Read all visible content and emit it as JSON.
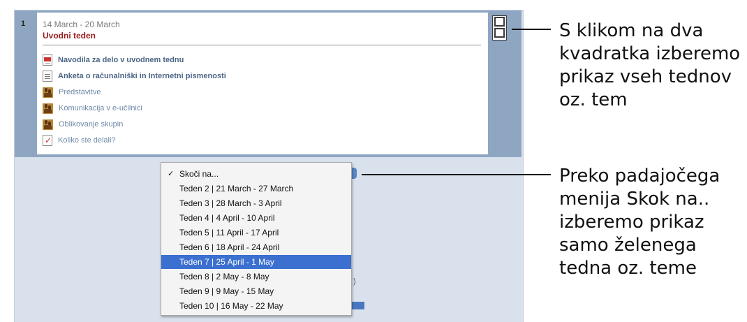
{
  "week": {
    "number": "1",
    "date_range": "14 March - 20 March",
    "title": "Uvodni teden",
    "activities": [
      {
        "icon": "pdf-icon",
        "label": "Navodila za delo v uvodnem tednu",
        "bold": true
      },
      {
        "icon": "document-icon",
        "label": "Anketa o računalniški in Internetni pismenosti",
        "bold": true
      },
      {
        "icon": "forum-icon",
        "label": "Predstavitve",
        "bold": false
      },
      {
        "icon": "forum-icon",
        "label": "Komunikacija v e-učilnici",
        "bold": false
      },
      {
        "icon": "forum-icon",
        "label": "Oblikovanje skupin",
        "bold": false
      },
      {
        "icon": "quiz-icon",
        "label": "Koliko ste delali?",
        "bold": false
      }
    ]
  },
  "jump_menu": {
    "options": [
      {
        "label": "Skoči na...",
        "checked": true,
        "selected": false
      },
      {
        "label": "Teden 2 | 21 March - 27 March",
        "checked": false,
        "selected": false
      },
      {
        "label": "Teden 3 | 28 March - 3 April",
        "checked": false,
        "selected": false
      },
      {
        "label": "Teden 4 | 4 April - 10 April",
        "checked": false,
        "selected": false
      },
      {
        "label": "Teden 5 | 11 April - 17 April",
        "checked": false,
        "selected": false
      },
      {
        "label": "Teden 6 | 18 April - 24 April",
        "checked": false,
        "selected": false
      },
      {
        "label": "Teden 7 | 25 April - 1 May",
        "checked": false,
        "selected": true
      },
      {
        "label": "Teden 8 | 2 May - 8 May",
        "checked": false,
        "selected": false
      },
      {
        "label": "Teden 9 | 9 May - 15 May",
        "checked": false,
        "selected": false
      },
      {
        "label": "Teden 10 | 16 May - 22 May",
        "checked": false,
        "selected": false
      }
    ],
    "check_mark": "✓"
  },
  "obscured": {
    "paren_text": ")"
  },
  "callouts": {
    "toggle": [
      "S klikom na dva",
      "kvadratka izberemo",
      "prikaz vseh tednov",
      "oz. tem"
    ],
    "dropdown": [
      "Preko padajočega",
      "menija Skok na..",
      "izberemo prikaz",
      "samo želenega",
      "tedna oz. teme"
    ]
  },
  "colors": {
    "panel_bg": "#d8e1ec",
    "week_side_bar": "#8ea6c2",
    "title_red": "#9b1b1b",
    "link_blue": "#4b6585",
    "selection_blue": "#3b6fd0"
  }
}
